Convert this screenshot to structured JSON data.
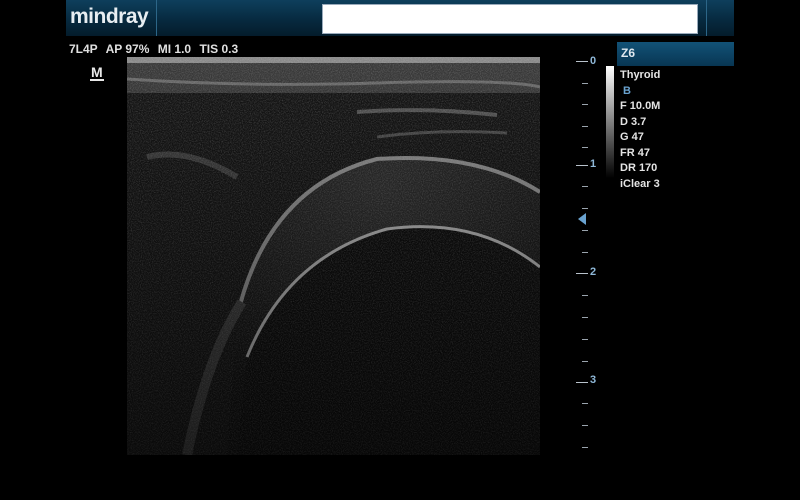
{
  "header": {
    "logo": "mindray",
    "patient_field": ""
  },
  "params": {
    "probe": "7L4P",
    "ap": "AP 97%",
    "mi": "MI 1.0",
    "tis": "TIS 0.3"
  },
  "marker": "M",
  "scale": {
    "labels": [
      "0",
      "1",
      "2",
      "3"
    ]
  },
  "panel": {
    "zoom": "Z6",
    "preset": "Thyroid",
    "mode": "B",
    "items": [
      "F 10.0M",
      "D 3.7",
      "G 47",
      "FR 47",
      "DR 170",
      "iClear 3"
    ]
  }
}
